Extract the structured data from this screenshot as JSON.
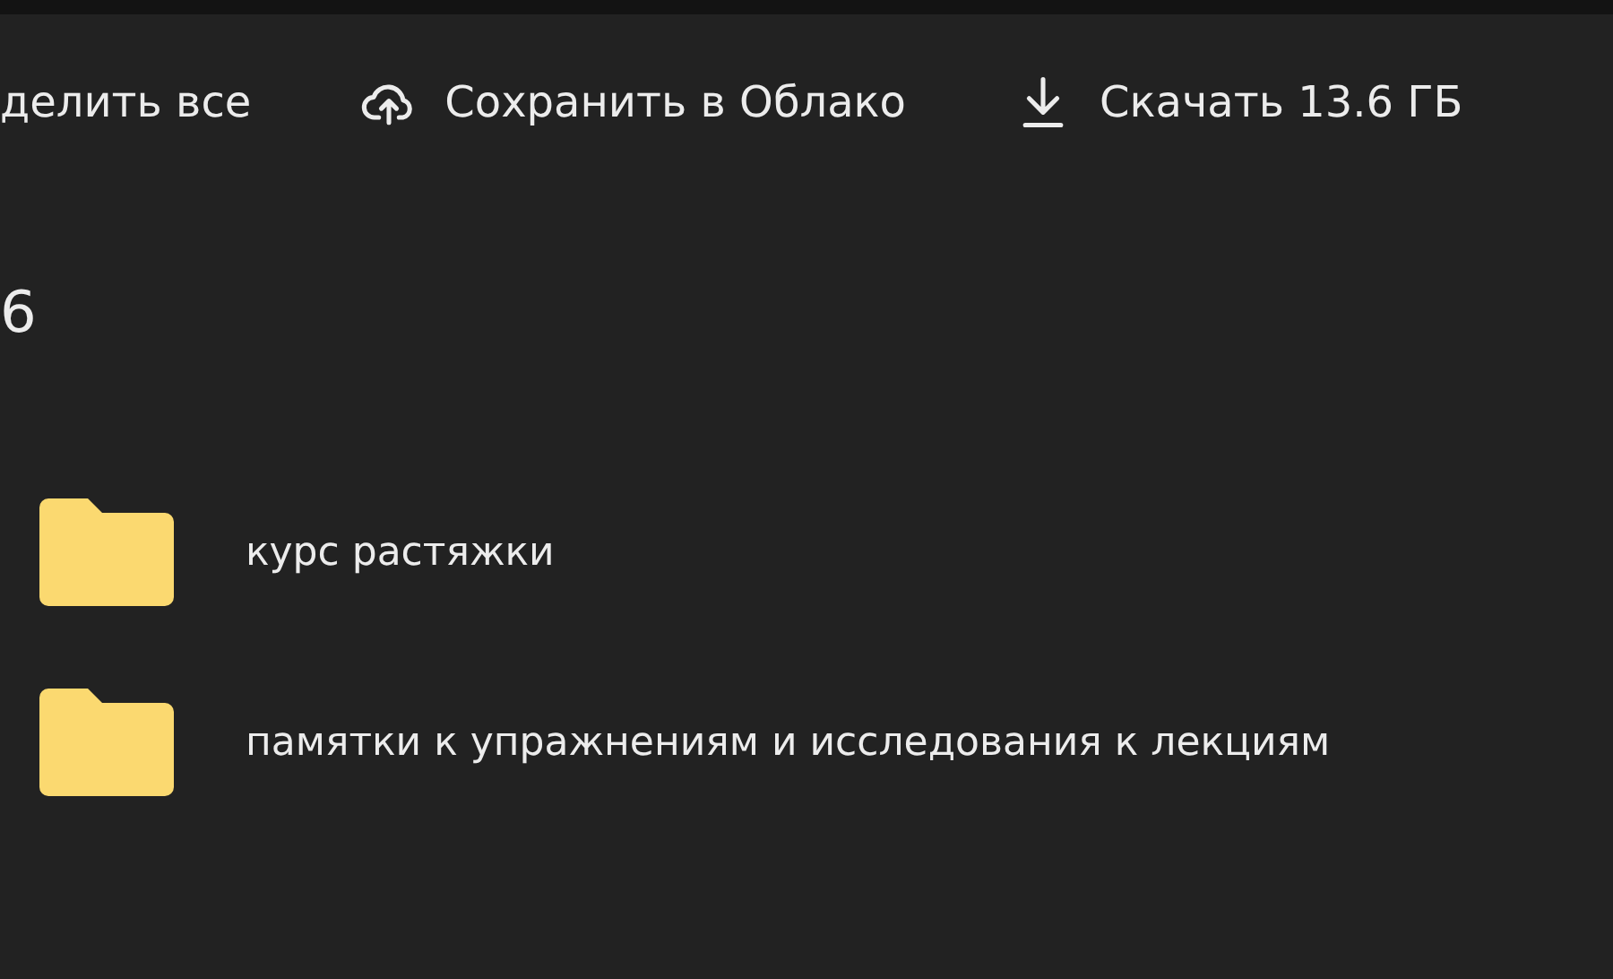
{
  "toolbar": [
    {
      "kind": "plain",
      "label": "делить все"
    },
    {
      "kind": "cloud",
      "label": "Сохранить в Облако"
    },
    {
      "kind": "download",
      "label": "Скачать 13.6 ГБ"
    }
  ],
  "heading": "6",
  "items": [
    {
      "kind": "folder",
      "name": "курс растяжки"
    },
    {
      "kind": "folder",
      "name": "памятки к упражнениям и исследования к лекциям"
    }
  ]
}
